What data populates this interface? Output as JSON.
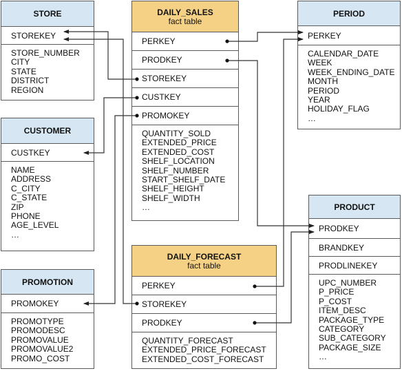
{
  "tables": {
    "store": {
      "title": "STORE",
      "keys": [
        "STOREKEY"
      ],
      "attributes": [
        "STORE_NUMBER",
        "CITY",
        "STATE",
        "DISTRICT",
        "REGION"
      ]
    },
    "customer": {
      "title": "CUSTOMER",
      "keys": [
        "CUSTKEY"
      ],
      "attributes": [
        "NAME",
        "ADDRESS",
        "C_CITY",
        "C_STATE",
        "ZIP",
        "PHONE",
        "AGE_LEVEL",
        "…"
      ]
    },
    "promotion": {
      "title": "PROMOTION",
      "keys": [
        "PROMOKEY"
      ],
      "attributes": [
        "PROMOTYPE",
        "PROMODESC",
        "PROMOVALUE",
        "PROMOVALUE2",
        "PROMO_COST"
      ]
    },
    "daily_sales": {
      "title": "DAILY_SALES",
      "subtitle": "fact table",
      "keys": [
        "PERKEY",
        "PRODKEY",
        "STOREKEY",
        "CUSTKEY",
        "PROMOKEY"
      ],
      "attributes": [
        "QUANTITY_SOLD",
        "EXTENDED_PRICE",
        "EXTENDED_COST",
        "SHELF_LOCATION",
        "SHELF_NUMBER",
        "START_SHELF_DATE",
        "SHELF_HEIGHT",
        "SHELF_WIDTH",
        "…"
      ]
    },
    "daily_forecast": {
      "title": "DAILY_FORECAST",
      "subtitle": "fact table",
      "keys": [
        "PERKEY",
        "STOREKEY",
        "PRODKEY"
      ],
      "attributes": [
        "QUANTITY_FORECAST",
        "EXTENDED_PRICE_FORECAST",
        "EXTENDED_COST_FORECAST"
      ]
    },
    "period": {
      "title": "PERIOD",
      "keys": [
        "PERKEY"
      ],
      "attributes": [
        "CALENDAR_DATE",
        "WEEK",
        "WEEK_ENDING_DATE",
        "MONTH",
        "PERIOD",
        "YEAR",
        "HOLIDAY_FLAG",
        "…"
      ]
    },
    "product": {
      "title": "PRODUCT",
      "keys": [
        "PRODKEY",
        "BRANDKEY",
        "PRODLINEKEY"
      ],
      "attributes": [
        "UPC_NUMBER",
        "P_PRICE",
        "P_COST",
        "ITEM_DESC",
        "PACKAGE_TYPE",
        "CATEGORY",
        "SUB_CATEGORY",
        "PACKAGE_SIZE",
        "…"
      ]
    }
  },
  "relationships": [
    {
      "from": "DAILY_SALES.STOREKEY",
      "to": "STORE.STOREKEY"
    },
    {
      "from": "DAILY_FORECAST.STOREKEY",
      "to": "STORE.STOREKEY"
    },
    {
      "from": "DAILY_SALES.CUSTKEY",
      "to": "CUSTOMER.CUSTKEY"
    },
    {
      "from": "DAILY_SALES.PROMOKEY",
      "to": "PROMOTION.PROMOKEY"
    },
    {
      "from": "DAILY_SALES.PERKEY",
      "to": "PERIOD.PERKEY"
    },
    {
      "from": "DAILY_FORECAST.PERKEY",
      "to": "PERIOD.PERKEY"
    },
    {
      "from": "DAILY_SALES.PRODKEY",
      "to": "PRODUCT.PRODKEY"
    },
    {
      "from": "DAILY_FORECAST.PRODKEY",
      "to": "PRODUCT.PRODKEY"
    }
  ],
  "colors": {
    "dimension_header": "#d6e7f3",
    "fact_header": "#f5d185",
    "border": "#5a5a5a",
    "connector": "#333333"
  }
}
